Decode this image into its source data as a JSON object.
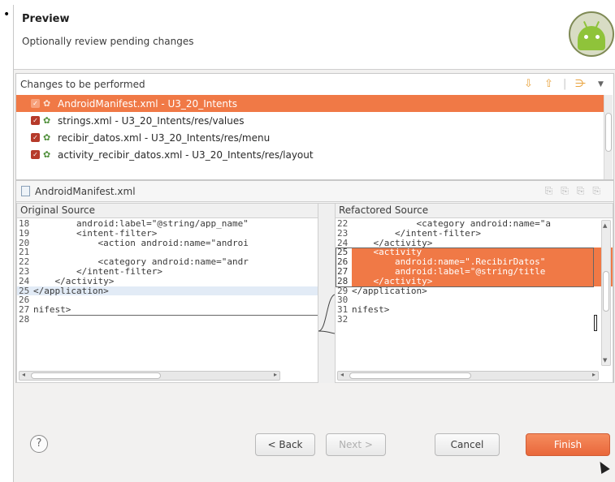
{
  "header": {
    "title": "Preview",
    "subtitle": "Optionally review pending changes"
  },
  "changes": {
    "title": "Changes to be performed",
    "items": [
      {
        "label": "AndroidManifest.xml - U3_20_Intents",
        "selected": true
      },
      {
        "label": "strings.xml - U3_20_Intents/res/values",
        "selected": false
      },
      {
        "label": "recibir_datos.xml - U3_20_Intents/res/menu",
        "selected": false
      },
      {
        "label": "activity_recibir_datos.xml - U3_20_Intents/res/layout",
        "selected": false
      }
    ]
  },
  "compare": {
    "file": "AndroidManifest.xml",
    "original": {
      "title": "Original Source",
      "lines": [
        {
          "n": "18",
          "text": "        android:label=\"@string/app_name\""
        },
        {
          "n": "19",
          "text": "        <intent-filter>"
        },
        {
          "n": "20",
          "text": "            <action android:name=\"androi"
        },
        {
          "n": "21",
          "text": ""
        },
        {
          "n": "22",
          "text": "            <category android:name=\"andr"
        },
        {
          "n": "23",
          "text": "        </intent-filter>"
        },
        {
          "n": "24",
          "text": "    </activity>"
        },
        {
          "n": "25",
          "text": "</application>"
        },
        {
          "n": "26",
          "text": ""
        },
        {
          "n": "27",
          "text": "nifest>"
        },
        {
          "n": "28",
          "text": ""
        }
      ]
    },
    "refactored": {
      "title": "Refactored Source",
      "lines": [
        {
          "n": "22",
          "text": "            <category android:name=\"a"
        },
        {
          "n": "23",
          "text": "        </intent-filter>"
        },
        {
          "n": "24",
          "text": "    </activity>"
        },
        {
          "n": "25",
          "text": "    <activity"
        },
        {
          "n": "26",
          "text": "        android:name=\".RecibirDatos\""
        },
        {
          "n": "27",
          "text": "        android:label=\"@string/title"
        },
        {
          "n": "28",
          "text": "    </activity>"
        },
        {
          "n": "29",
          "text": "</application>"
        },
        {
          "n": "30",
          "text": ""
        },
        {
          "n": "31",
          "text": "nifest>"
        },
        {
          "n": "32",
          "text": ""
        }
      ]
    }
  },
  "footer": {
    "help": "?",
    "back": "< Back",
    "next": "Next >",
    "cancel": "Cancel",
    "finish": "Finish"
  },
  "colors": {
    "selection": "#f07946",
    "finish_button": "#ee7a4a"
  }
}
